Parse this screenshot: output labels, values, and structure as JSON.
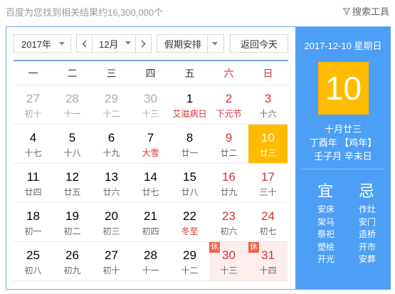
{
  "header": {
    "result_count": "百度为您找到相关结果约16,300,000个",
    "search_tools": "搜索工具"
  },
  "controls": {
    "year": "2017年",
    "month": "12月",
    "holiday": "假期安排",
    "today_button": "返回今天"
  },
  "weekdays": [
    "一",
    "二",
    "三",
    "四",
    "五",
    "六",
    "日"
  ],
  "weeks": [
    [
      {
        "day": "27",
        "lunar": "初十",
        "other": true
      },
      {
        "day": "28",
        "lunar": "十一",
        "other": true
      },
      {
        "day": "29",
        "lunar": "十二",
        "other": true
      },
      {
        "day": "30",
        "lunar": "十三",
        "other": true
      },
      {
        "day": "1",
        "lunar": "艾滋病日",
        "festival": true
      },
      {
        "day": "2",
        "lunar": "下元节",
        "weekend": true,
        "festival": true
      },
      {
        "day": "3",
        "lunar": "十六",
        "weekend": true
      }
    ],
    [
      {
        "day": "4",
        "lunar": "十七"
      },
      {
        "day": "5",
        "lunar": "十八"
      },
      {
        "day": "6",
        "lunar": "十九"
      },
      {
        "day": "7",
        "lunar": "大雪",
        "festival": true
      },
      {
        "day": "8",
        "lunar": "廿一"
      },
      {
        "day": "9",
        "lunar": "廿二",
        "weekend": true
      },
      {
        "day": "10",
        "lunar": "廿三",
        "weekend": true,
        "selected": true
      }
    ],
    [
      {
        "day": "11",
        "lunar": "廿四"
      },
      {
        "day": "12",
        "lunar": "廿五"
      },
      {
        "day": "13",
        "lunar": "廿六"
      },
      {
        "day": "14",
        "lunar": "廿七"
      },
      {
        "day": "15",
        "lunar": "廿八"
      },
      {
        "day": "16",
        "lunar": "廿九",
        "weekend": true
      },
      {
        "day": "17",
        "lunar": "三十",
        "weekend": true
      }
    ],
    [
      {
        "day": "18",
        "lunar": "初一"
      },
      {
        "day": "19",
        "lunar": "初二"
      },
      {
        "day": "20",
        "lunar": "初三"
      },
      {
        "day": "21",
        "lunar": "初四"
      },
      {
        "day": "22",
        "lunar": "冬至",
        "festival": true
      },
      {
        "day": "23",
        "lunar": "初六",
        "weekend": true
      },
      {
        "day": "24",
        "lunar": "初七",
        "weekend": true
      }
    ],
    [
      {
        "day": "25",
        "lunar": "初八"
      },
      {
        "day": "26",
        "lunar": "初九"
      },
      {
        "day": "27",
        "lunar": "初十"
      },
      {
        "day": "28",
        "lunar": "十一"
      },
      {
        "day": "29",
        "lunar": "十二"
      },
      {
        "day": "30",
        "lunar": "十三",
        "weekend": true,
        "rest": "休"
      },
      {
        "day": "31",
        "lunar": "十四",
        "weekend": true,
        "rest": "休"
      }
    ]
  ],
  "side": {
    "date_line": "2017-12-10 星期日",
    "big_day": "10",
    "lunar_date": "十月廿三",
    "ganzhi_year": "丁酉年 【鸡年】",
    "ganzhi_month_day": "壬子月 辛未日",
    "yi_title": "宜",
    "ji_title": "忌",
    "yi": [
      "安床",
      "架马",
      "祭祀",
      "塑绘",
      "开光"
    ],
    "ji": [
      "作灶",
      "安门",
      "造桥",
      "开市",
      "安葬"
    ]
  },
  "colors": {
    "accent_blue": "#4d9ff5",
    "selected_yellow": "#ffbb00",
    "weekend_red": "#d43030",
    "rest_badge": "#f0624c"
  }
}
